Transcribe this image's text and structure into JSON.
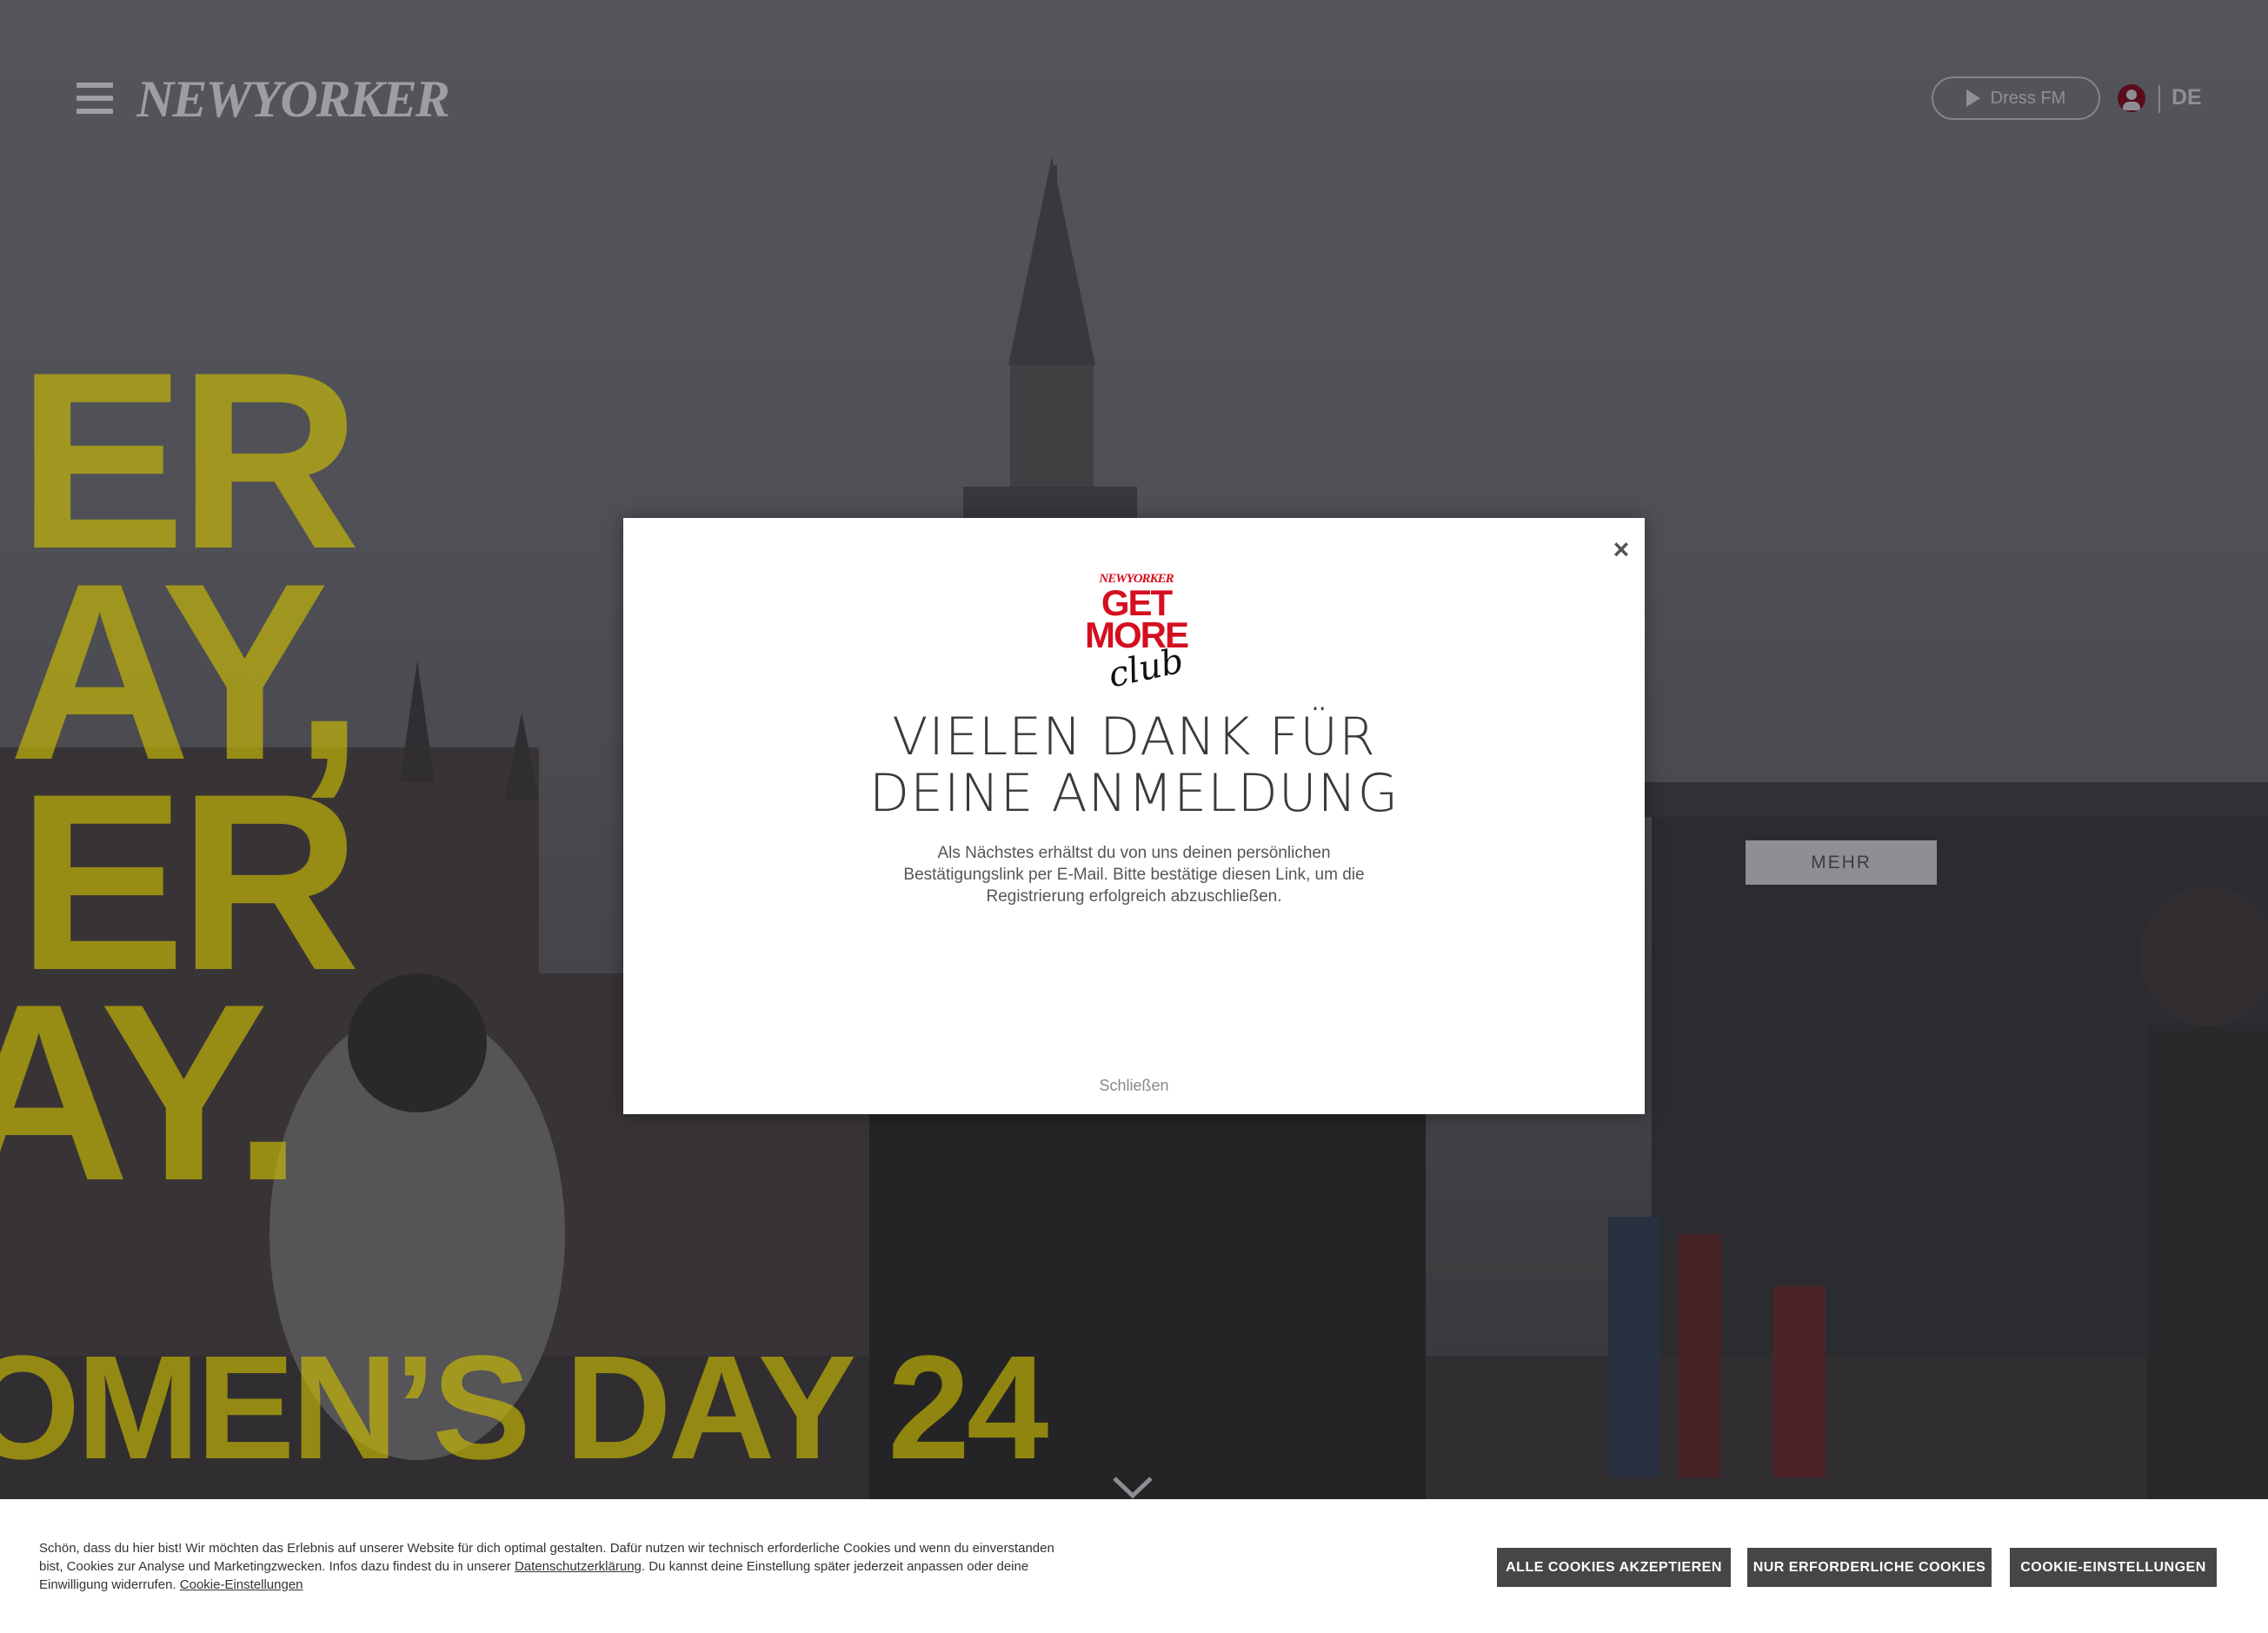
{
  "header": {
    "logo_text": "NEWYORKER",
    "dress_fm_label": "Dress FM",
    "language": "DE"
  },
  "hero": {
    "lines": [
      "ER",
      "AY,",
      "ER",
      "AY.",
      "OMEN’S DAY 24"
    ],
    "more_button": "MEHR"
  },
  "modal": {
    "club_logo": {
      "brand": "NEWYORKER",
      "line1": "GET",
      "line2": "MORE",
      "script": "club"
    },
    "title_line1": "VIELEN DANK FÜR",
    "title_line2": "DEINE ANMELDUNG",
    "body": "Als Nächstes erhältst du von uns deinen persönlichen Bestätigungslink per E-Mail. Bitte bestätige diesen Link, um die Registrierung erfolgreich abzuschließen.",
    "close_link": "Schließen",
    "close_icon": "×"
  },
  "cookie_bar": {
    "text_part1": "Schön, dass du hier bist! Wir möchten das Erlebnis auf unserer Website für dich optimal gestalten. Dafür nutzen wir technisch erforderliche Cookies und wenn du einverstanden bist, Cookies zur Analyse und Marketingzwecken. Infos dazu findest du in unserer",
    "privacy_link": "Datenschutzerklärung",
    "text_part2": ". Du kannst deine Einstellung später jederzeit anpassen oder deine Einwilligung widerrufen.",
    "settings_link": "Cookie-Einstellungen",
    "accept_all": "ALLE COOKIES AKZEPTIEREN",
    "necessary_only": "NUR ERFORDERLICHE COOKIES",
    "settings_button": "COOKIE-EINSTELLUNGEN"
  },
  "colors": {
    "accent_yellow": "#d2c200",
    "brand_red": "#d40f1f",
    "button_dark": "#464646"
  }
}
